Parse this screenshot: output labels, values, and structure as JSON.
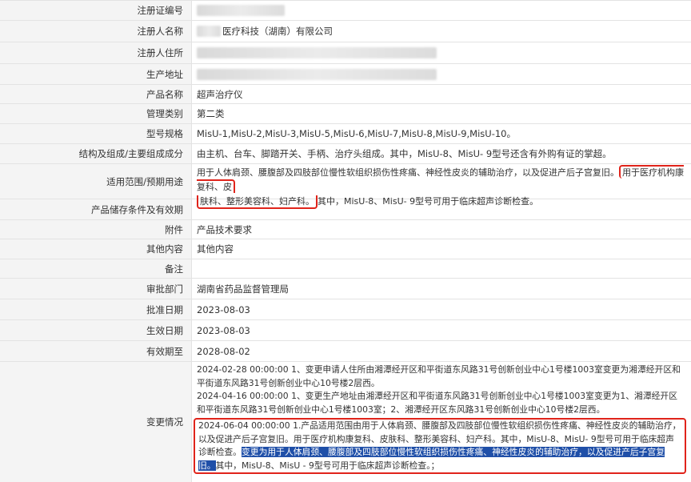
{
  "rows": {
    "reg_no": {
      "label": "注册证编号",
      "value": "",
      "redacted": true
    },
    "registrant": {
      "label": "注册人名称",
      "value": "医疗科技（湖南）有限公司",
      "redacted_prefix": true
    },
    "address": {
      "label": "注册人住所",
      "value": "",
      "redacted": true
    },
    "production_address": {
      "label": "生产地址",
      "value": "",
      "redacted": true
    },
    "product_name": {
      "label": "产品名称",
      "value": "超声治疗仪"
    },
    "mgmt_class": {
      "label": "管理类别",
      "value": "第二类"
    },
    "models": {
      "label": "型号规格",
      "value": "MisU-1,MisU-2,MisU-3,MisU-5,MisU-6,MisU-7,MisU-8,MisU-9,MisU-10。"
    },
    "composition": {
      "label": "结构及组成/主要组成成分",
      "value": "由主机、台车、脚踏开关、手柄、治疗头组成。其中，MisU-8、MisU- 9型号还含有外购有证的掌超。"
    },
    "scope": {
      "label": "适用范围/预期用途",
      "part1": "用于人体肩颈、腰腹部及四肢部位慢性软组织损伤性疼痛、神经性皮炎的辅助治疗，以及促进产后子宫复旧。",
      "part2a": "用于医疗机构康复科、皮",
      "part2b": "肤科、整形美容科、妇产科。",
      "part3": "其中，MisU-8、MisU- 9型号可用于临床超声诊断检查。"
    },
    "storage": {
      "label": "产品储存条件及有效期",
      "value": ""
    },
    "attachment": {
      "label": "附件",
      "value": "产品技术要求"
    },
    "other": {
      "label": "其他内容",
      "value": "其他内容"
    },
    "remark": {
      "label": "备注",
      "value": ""
    },
    "approval_dept": {
      "label": "审批部门",
      "value": "湖南省药品监督管理局"
    },
    "approval_date": {
      "label": "批准日期",
      "value": "2023-08-03"
    },
    "effective_date": {
      "label": "生效日期",
      "value": "2023-08-03"
    },
    "valid_until": {
      "label": "有效期至",
      "value": "2028-08-02"
    },
    "changes": {
      "label": "变更情况",
      "entry1": "2024-02-28 00:00:00 1、变更申请人住所由湘潭经开区和平街道东风路31号创新创业中心1号楼1003室变更为湘潭经开区和平街道东风路31号创新创业中心10号楼2层西。",
      "entry2": "2024-04-16 00:00:00 1、变更生产地址由湘潭经开区和平街道东风路31号创新创业中心1号楼1003室变更为1、湘潭经开区和平街道东风路31号创新创业中心1号楼1003室；2、湘潭经开区东风路31号创新创业中心10号楼2层西。",
      "entry3_a": "2024-06-04 00:00:00 1.产品适用范围由用于人体肩颈、腰腹部及四肢部位慢性软组织损伤性疼痛、神经性皮炎的辅助治疗，以及促进产后子宫复旧。用于医疗机构康复科、皮肤科、整形美容科、妇产科。其中，MisU-8、MisU- 9型号可用于临床超声诊断检查。",
      "entry3_hl": "变更为用于人体肩颈、腰腹部及四肢部位慢性软组织损伤性疼痛、神经性皮炎的辅助治疗，以及促进产后子宫复旧。",
      "entry3_b": "其中，MisU-8、MisU - 9型号可用于临床超声诊断检查。；"
    }
  }
}
